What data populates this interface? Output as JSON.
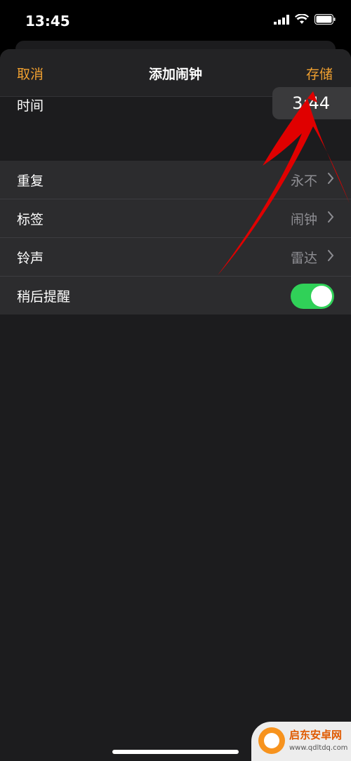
{
  "status": {
    "time": "13:45",
    "icons": [
      "signal-icon",
      "wifi-icon",
      "battery-icon"
    ]
  },
  "nav": {
    "cancel_label": "取消",
    "title": "添加闹钟",
    "save_label": "存储"
  },
  "time_picker": {
    "label": "时间",
    "value": "3:44"
  },
  "settings": {
    "repeat": {
      "label": "重复",
      "value": "永不"
    },
    "label": {
      "label": "标签",
      "value": "闹钟"
    },
    "sound": {
      "label": "铃声",
      "value": "雷达"
    },
    "snooze": {
      "label": "稍后提醒",
      "enabled": true
    }
  },
  "watermark": {
    "name": "启东安卓网",
    "url": "www.qdltdq.com"
  },
  "colors": {
    "accent": "#f0a030",
    "toggle_on": "#30d158",
    "annotation": "#e00000"
  }
}
